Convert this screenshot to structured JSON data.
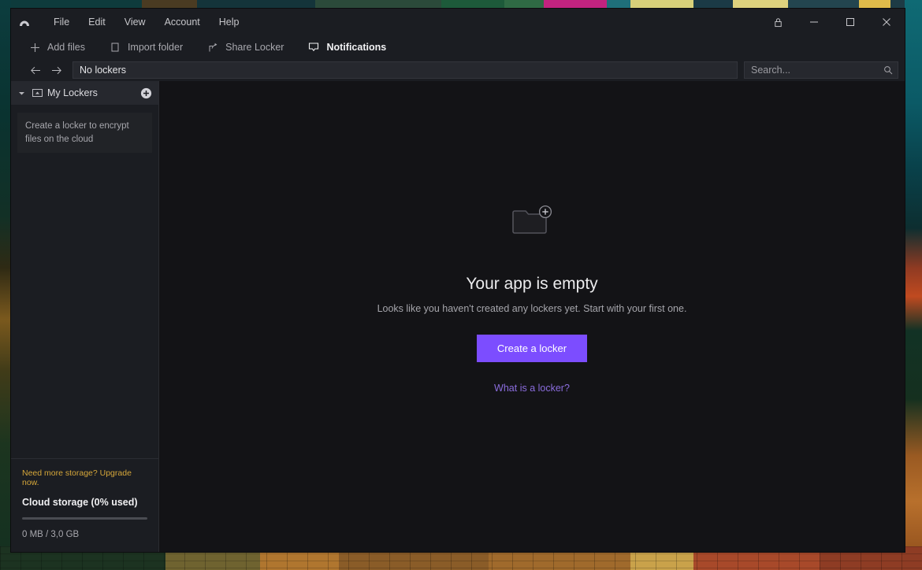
{
  "window": {
    "logo_icon": "nordlocker-arch-logo",
    "menu": [
      {
        "label": "File"
      },
      {
        "label": "Edit"
      },
      {
        "label": "View"
      },
      {
        "label": "Account"
      },
      {
        "label": "Help"
      }
    ],
    "controls": {
      "lock_icon": "lock-icon",
      "minimize_icon": "minimize-icon",
      "maximize_icon": "maximize-icon",
      "close_icon": "close-icon"
    }
  },
  "toolbar": {
    "items": [
      {
        "label": "Add files",
        "icon": "plus-icon",
        "active": false
      },
      {
        "label": "Import folder",
        "icon": "folder-import-icon",
        "active": false
      },
      {
        "label": "Share Locker",
        "icon": "share-icon",
        "active": false
      },
      {
        "label": "Notifications",
        "icon": "notification-bell-icon",
        "active": true
      }
    ]
  },
  "pathbar": {
    "back_icon": "arrow-left-icon",
    "forward_icon": "arrow-right-icon",
    "path_value": "No lockers"
  },
  "search": {
    "value": "",
    "placeholder": "Search...",
    "icon": "search-icon"
  },
  "sidebar": {
    "header": {
      "label": "My Lockers",
      "chevron_icon": "chevron-down-icon",
      "folder_icon": "locker-folder-icon",
      "add_icon": "add-circle-icon"
    },
    "hint": "Create a locker to encrypt files on the cloud",
    "storage": {
      "upgrade_text": "Need more storage? Upgrade now.",
      "title": "Cloud storage (0% used)",
      "percent_used": 0,
      "usage_text": "0 MB / 3,0 GB"
    }
  },
  "main": {
    "empty_state": {
      "icon": "folder-plus-icon",
      "title": "Your app is empty",
      "subtitle": "Looks like you haven't created any lockers yet. Start with your first one.",
      "primary_button": "Create a locker",
      "help_link": "What is a locker?"
    }
  },
  "colors": {
    "accent_purple": "#7c4dff",
    "link_purple": "#8b6ddd",
    "upgrade_amber": "#d6a73a",
    "window_bg": "#131316",
    "chrome_bg": "#1b1d22"
  }
}
